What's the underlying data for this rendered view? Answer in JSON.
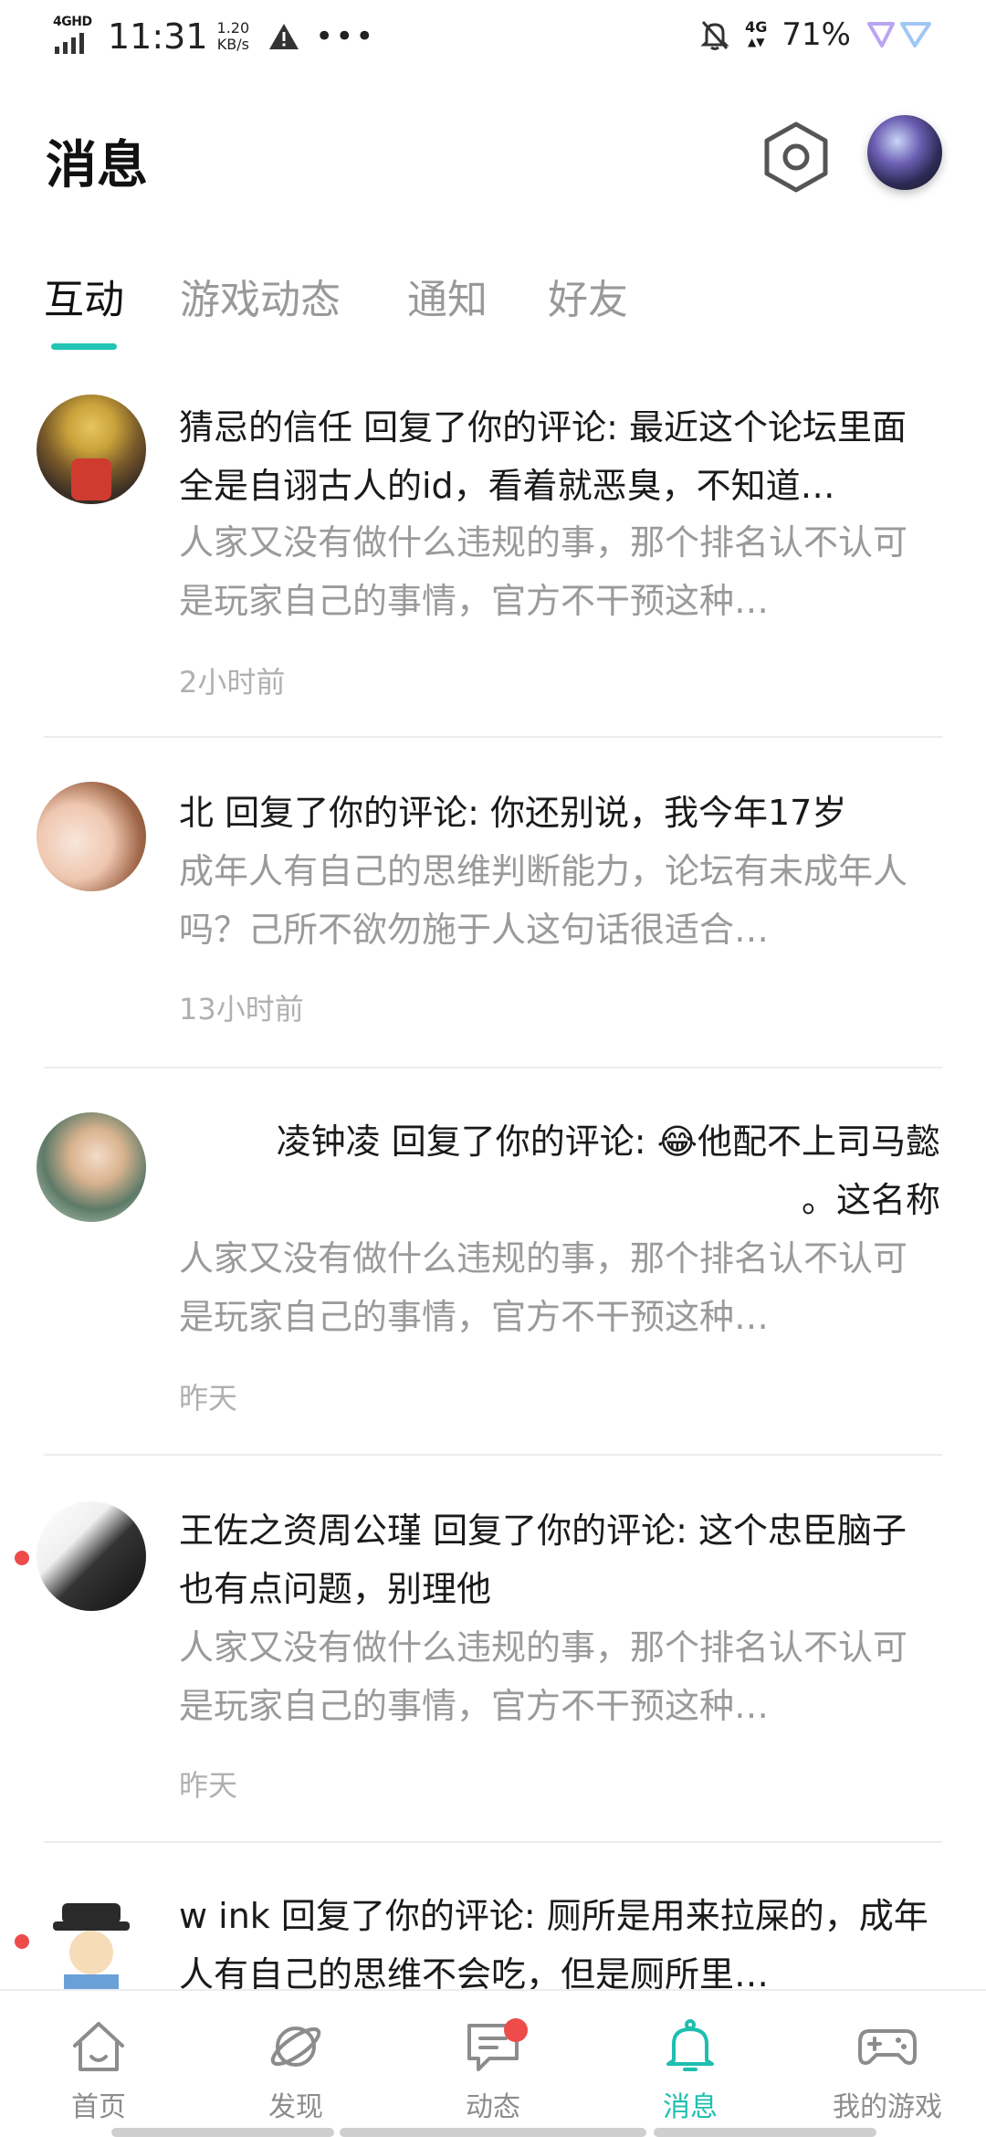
{
  "status_bar": {
    "network": "4GHD",
    "time": "11:31",
    "speed_value": "1.20",
    "speed_unit": "KB/s",
    "mobile": "4G",
    "battery": "71%"
  },
  "header": {
    "title": "消息",
    "settings_icon": "settings-hexagon-icon"
  },
  "tabs": [
    {
      "label": "互动",
      "active": true
    },
    {
      "label": "游戏动态",
      "active": false
    },
    {
      "label": "通知",
      "active": false
    },
    {
      "label": "好友",
      "active": false
    }
  ],
  "messages": [
    {
      "title": "猜忌的信任 回复了你的评论: 最近这个论坛里面全是自诩古人的id，看着就恶臭，不知道…",
      "quote": "人家又没有做什么违规的事，那个排名认不认可是玩家自己的事情，官方不干预这种…",
      "time": "2小时前",
      "unread": false
    },
    {
      "title": "北 回复了你的评论: 你还别说，我今年17岁",
      "quote": "成年人有自己的思维判断能力，论坛有未成年人吗？己所不欲勿施于人这句话很适合…",
      "time": "13小时前",
      "unread": false
    },
    {
      "title_line1": "凌钟凌 回复了你的评论: 😂他配不上司马懿",
      "title_line2": "。这名称",
      "quote": "人家又没有做什么违规的事，那个排名认不认可是玩家自己的事情，官方不干预这种…",
      "time": "昨天",
      "unread": false
    },
    {
      "title": "王佐之资周公瑾 回复了你的评论: 这个忠臣脑子也有点问题，别理他",
      "quote": "人家又没有做什么违规的事，那个排名认不认可是玩家自己的事情，官方不干预这种…",
      "time": "昨天",
      "unread": true
    },
    {
      "title": "w ink 回复了你的评论: 厕所是用来拉屎的，成年人有自己的思维不会吃，但是厕所里…",
      "unread": true
    }
  ],
  "bottom_nav": [
    {
      "label": "首页",
      "icon": "home-icon",
      "active": false
    },
    {
      "label": "发现",
      "icon": "planet-icon",
      "active": false
    },
    {
      "label": "动态",
      "icon": "chat-bubble-icon",
      "active": false,
      "badge": true
    },
    {
      "label": "消息",
      "icon": "bell-icon",
      "active": true
    },
    {
      "label": "我的游戏",
      "icon": "gamepad-icon",
      "active": false
    }
  ],
  "colors": {
    "accent": "#22c4b4",
    "unread": "#ee4b4b",
    "secondary_text": "#9a9a9a"
  }
}
